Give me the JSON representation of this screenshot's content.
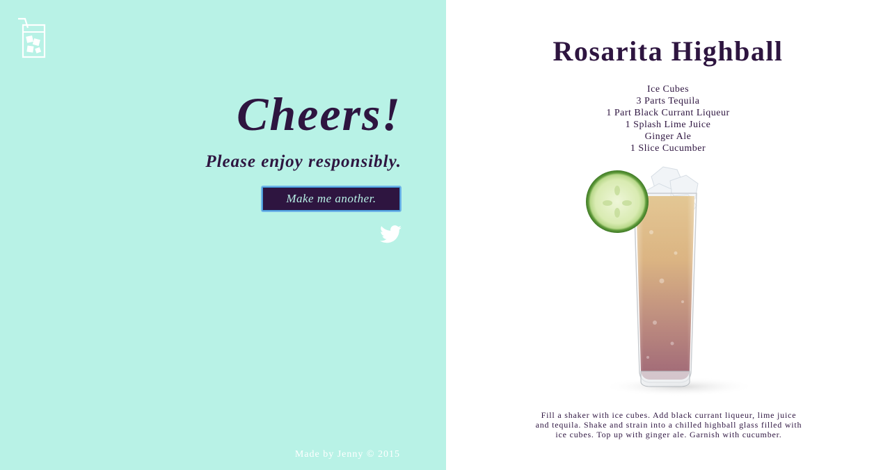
{
  "app": {
    "logo_icon": "glass-with-straw-icon"
  },
  "left_panel": {
    "heading": "Cheers!",
    "tagline": "Please enjoy responsibly.",
    "another_button_label": "Make me another.",
    "share_icon": "twitter-icon",
    "footer": "Made by Jenny © 2015",
    "background_color": "#b8f2e6",
    "text_color": "#2e1540"
  },
  "recipe": {
    "name": "Rosarita Highball",
    "ingredients": [
      "Ice Cubes",
      "3 Parts Tequila",
      "1 Part Black Currant Liqueur",
      "1 Splash Lime Juice",
      "Ginger Ale",
      "1 Slice Cucumber"
    ],
    "instructions": "Fill a shaker with ice cubes. Add black currant liqueur, lime juice and tequila. Shake and strain into a chilled highball glass filled with ice cubes. Top up with ginger ale. Garnish with cucumber.",
    "image": "highball-glass-with-cucumber-image"
  }
}
